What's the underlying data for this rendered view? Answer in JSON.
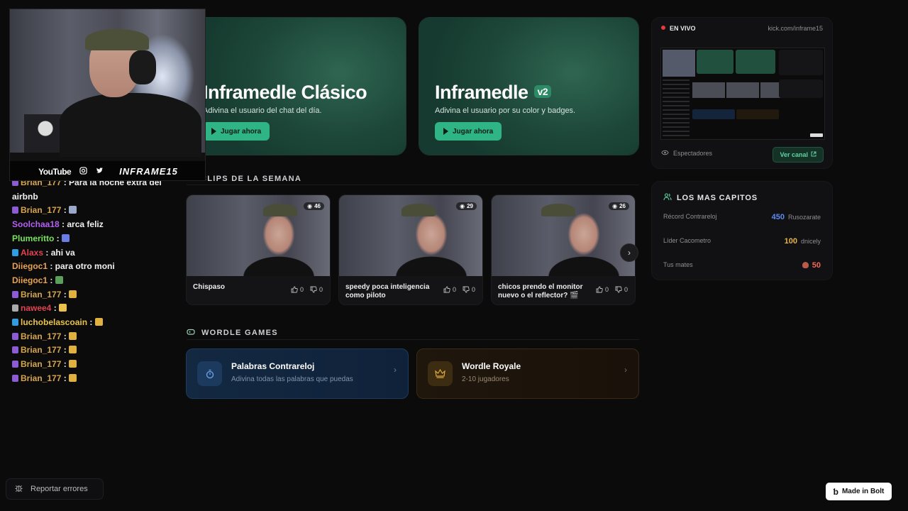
{
  "webcam": {
    "brand_youtube": "YouTube",
    "channel_name": "INFRAME15"
  },
  "chat": {
    "messages": [
      {
        "user": "Brian_177",
        "user_color": "#d6a54b",
        "text": " : Para la noche extra del airbnb",
        "badge_color": "#8c5bd6"
      },
      {
        "user": "Brian_177",
        "user_color": "#d6a54b",
        "text": " : ",
        "badge_color": "#8c5bd6",
        "emote_color": "#9aa9c9"
      },
      {
        "user": "Soolchaa18",
        "user_color": "#b260f0",
        "text": " : arca feliz"
      },
      {
        "user": "Plumeritto",
        "user_color": "#79e060",
        "text": " : ",
        "emote_color": "#6a7de0"
      },
      {
        "user": "Alaxs",
        "user_color": "#e0434f",
        "text": " : ahi va",
        "badge_color": "#2f9ee0"
      },
      {
        "user": "Diiegoc1",
        "user_color": "#e8a255",
        "text": " : para otro moni"
      },
      {
        "user": "Diiegoc1",
        "user_color": "#e8a255",
        "text": " : ",
        "emote_color": "#5aa05a"
      },
      {
        "user": "Brian_177",
        "user_color": "#d6a54b",
        "text": " : ",
        "badge_color": "#8c5bd6",
        "emote_color": "#e0b040"
      },
      {
        "user": "nawee4",
        "user_color": "#e0434f",
        "text": " : ",
        "badge_color": "#aaaaaa",
        "emote_color": "#e8c24a"
      },
      {
        "user": "luchobelascoain",
        "user_color": "#e8c24a",
        "text": " : ",
        "badge_color": "#2f9ee0",
        "emote_color": "#e0b040"
      },
      {
        "user": "Brian_177",
        "user_color": "#d6a54b",
        "text": " : ",
        "badge_color": "#8c5bd6",
        "emote_color": "#e0b040"
      },
      {
        "user": "Brian_177",
        "user_color": "#d6a54b",
        "text": " : ",
        "badge_color": "#8c5bd6",
        "emote_color": "#e0b040"
      },
      {
        "user": "Brian_177",
        "user_color": "#d6a54b",
        "text": " : ",
        "badge_color": "#8c5bd6",
        "emote_color": "#e0b040"
      },
      {
        "user": "Brian_177",
        "user_color": "#d6a54b",
        "text": " : ",
        "badge_color": "#8c5bd6",
        "emote_color": "#e0b040"
      }
    ],
    "report_label": "Reportar errores"
  },
  "hero": [
    {
      "title": "Inframedle Clásico",
      "subtitle": "Adivina el usuario del chat del día.",
      "button": "Jugar ahora"
    },
    {
      "title": "Inframedle",
      "tag": "v2",
      "subtitle": "Adivina el usuario por su color y badges.",
      "button": "Jugar ahora"
    }
  ],
  "clips": {
    "heading": "CLIPS DE LA SEMANA",
    "items": [
      {
        "title": "Chispaso",
        "views": "46",
        "likes": "0",
        "dislikes": "0"
      },
      {
        "title": "speedy poca inteligencia como piloto",
        "views": "29",
        "likes": "0",
        "dislikes": "0"
      },
      {
        "title": "chicos prendo el monitor nuevo o el reflector? 🎬",
        "views": "26",
        "likes": "0",
        "dislikes": "0"
      }
    ]
  },
  "wordle": {
    "heading": "WORDLE GAMES",
    "games": [
      {
        "title": "Palabras Contrareloj",
        "subtitle": "Adivina todas las palabras que puedas"
      },
      {
        "title": "Wordle Royale",
        "subtitle": "2-10 jugadores"
      }
    ]
  },
  "live": {
    "status": "EN VIVO",
    "url": "kick.com/inframe15",
    "viewers_label": "Espectadores",
    "button": "Ver canal"
  },
  "stats": {
    "heading": "LOS MAS CAPITOS",
    "rows": [
      {
        "label": "Récord Contrareloj",
        "value": "450",
        "user": "Rusozarate",
        "color": "#5b8cf0"
      },
      {
        "label": "Líder Cacometro",
        "value": "100",
        "user": "dnicely",
        "color": "#e8b34a"
      },
      {
        "label": "Tus mates",
        "value": "50",
        "user": "",
        "color": "#f06a55"
      }
    ]
  },
  "footer": {
    "bolt_label": "Made in Bolt"
  }
}
